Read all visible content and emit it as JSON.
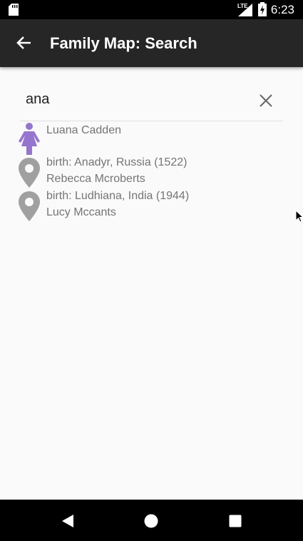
{
  "status_bar": {
    "time": "6:23",
    "network": "LTE"
  },
  "app_bar": {
    "title": "Family Map: Search"
  },
  "search": {
    "value": "ana"
  },
  "results": [
    {
      "type": "person",
      "icon": "female-person-icon",
      "icon_color": "#9575cd",
      "line1": "Luana Cadden",
      "line2": ""
    },
    {
      "type": "event",
      "icon": "map-pin-icon",
      "icon_color": "#a0a0a0",
      "line1": "birth: Anadyr, Russia (1522)",
      "line2": "Rebecca Mcroberts"
    },
    {
      "type": "event",
      "icon": "map-pin-icon",
      "icon_color": "#a0a0a0",
      "line1": "birth: Ludhiana, India (1944)",
      "line2": "Lucy Mccants"
    }
  ]
}
